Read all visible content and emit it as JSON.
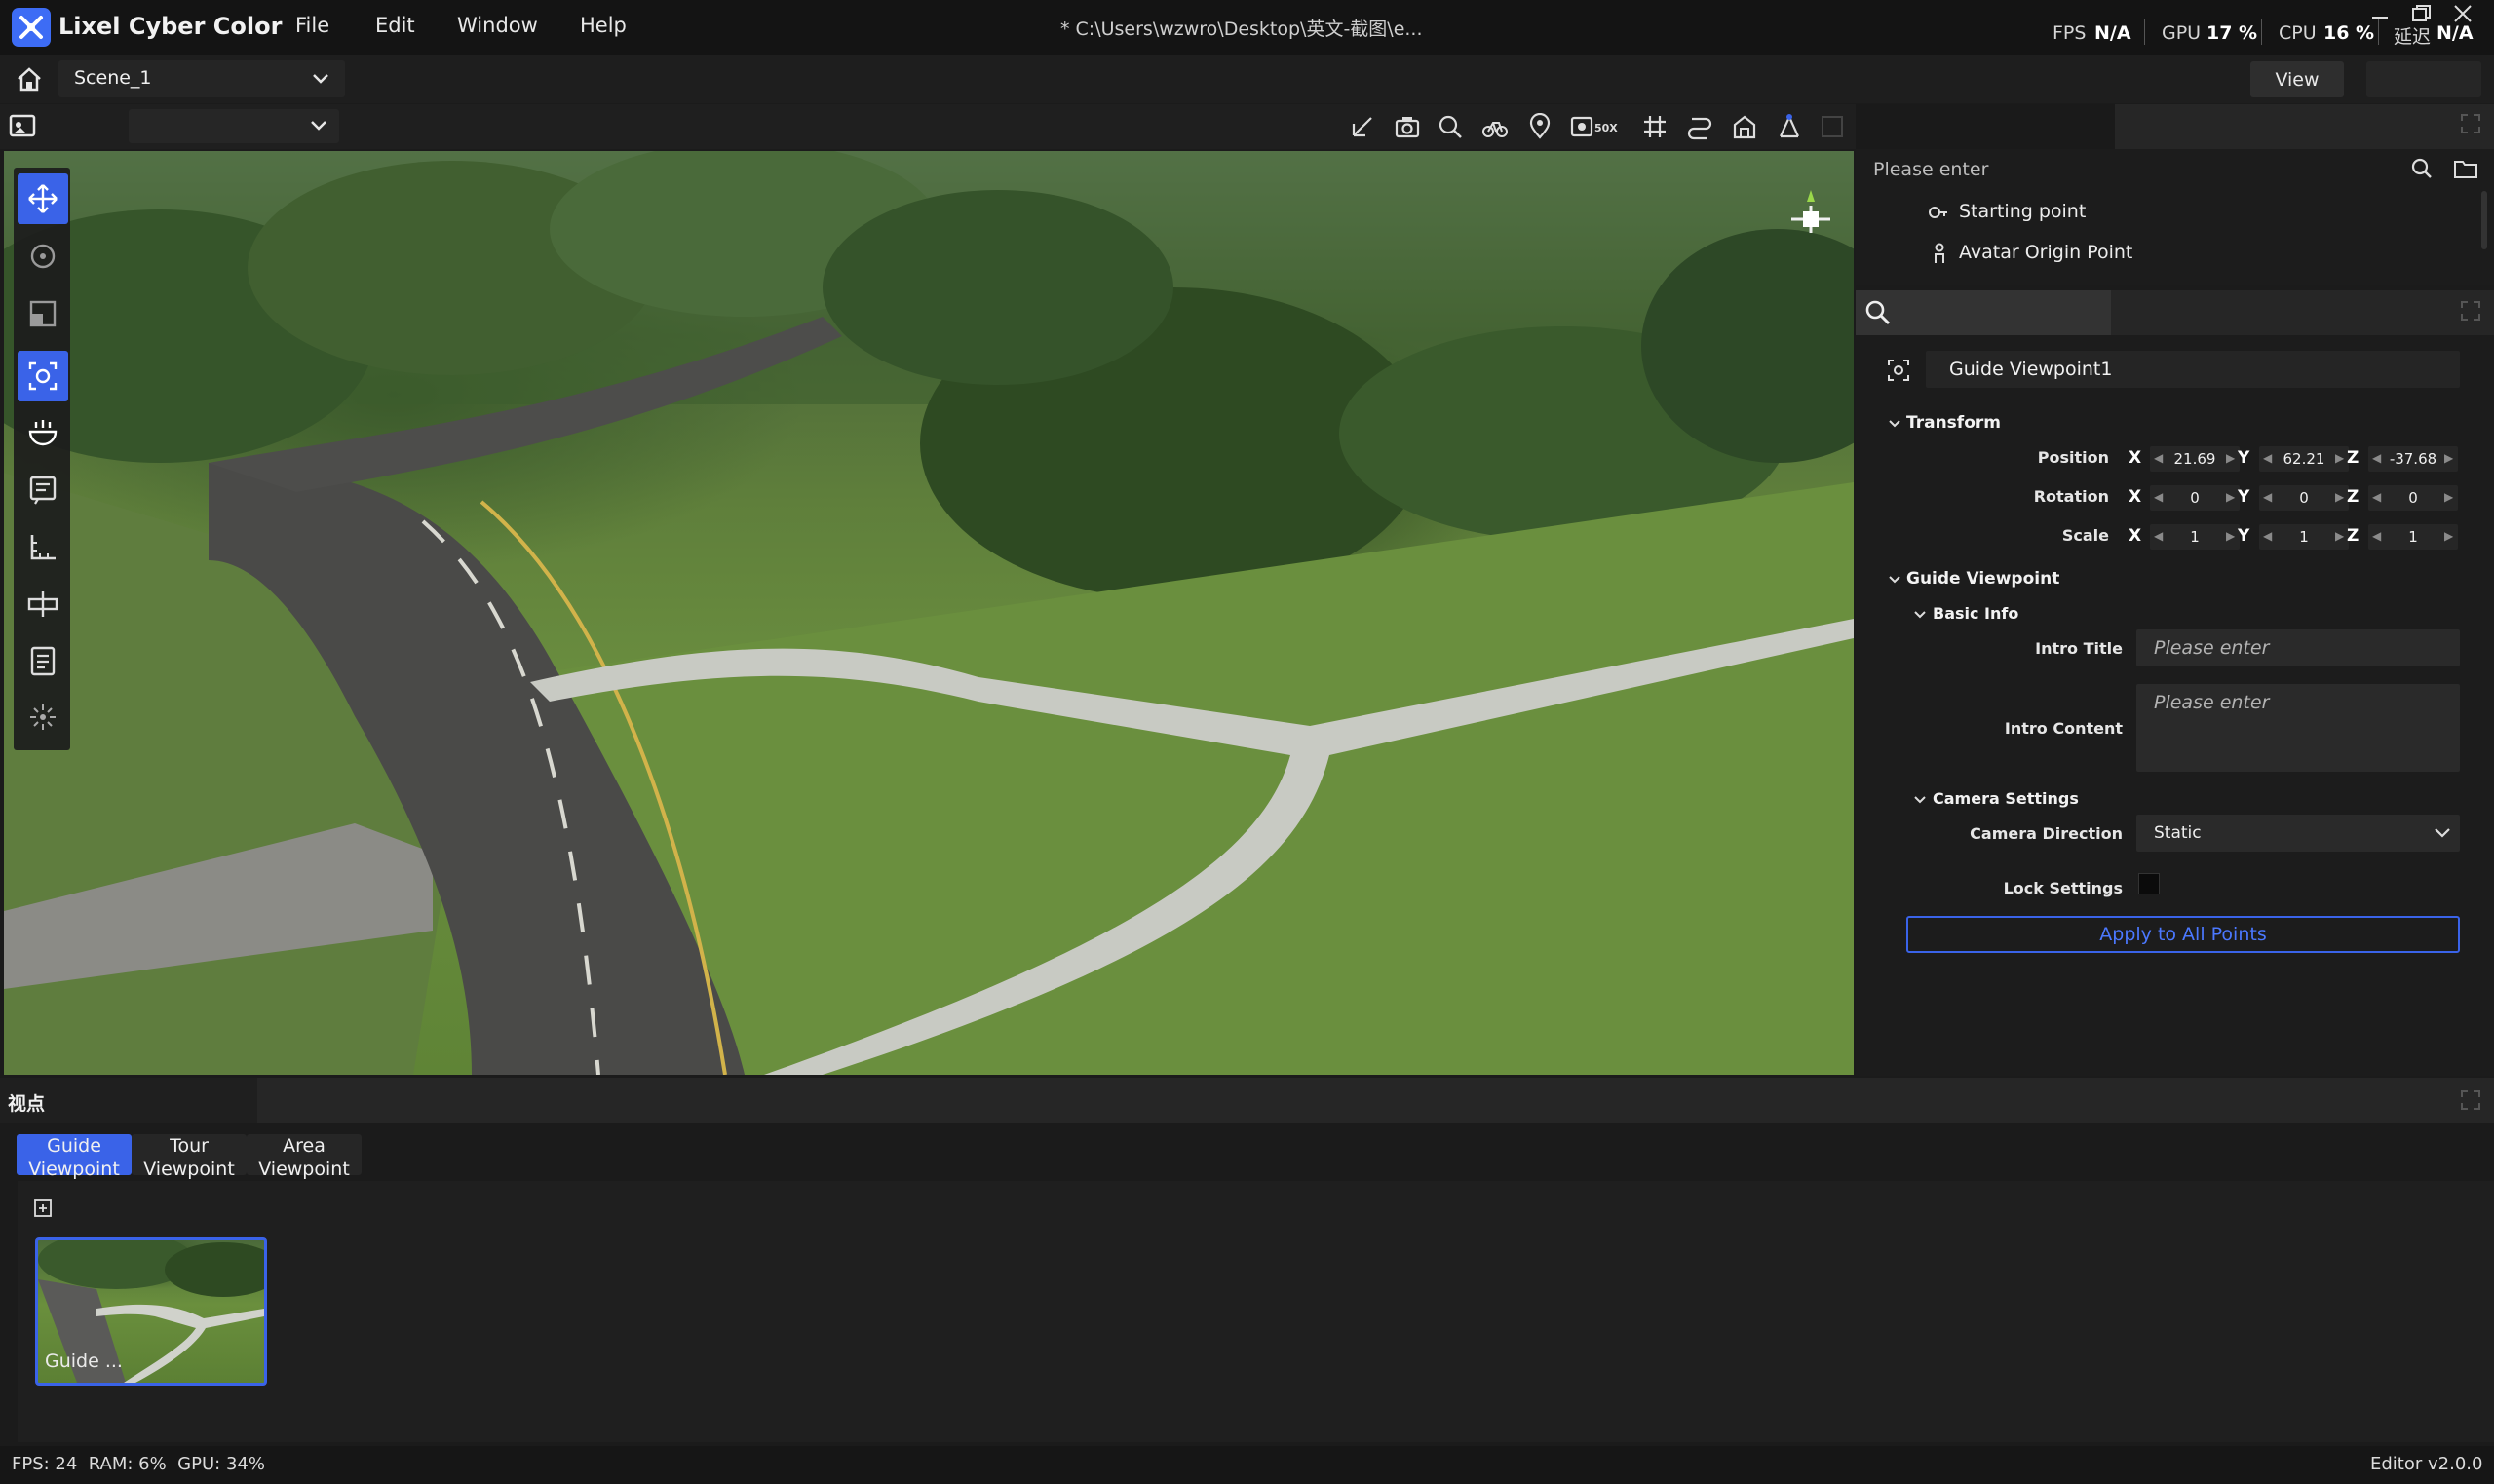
{
  "app": {
    "title": "Lixel Cyber Color",
    "menu": [
      "File",
      "Edit",
      "Window",
      "Help"
    ],
    "file_path": "* C:\\Users\\wzwro\\Desktop\\英文-截图\\e...",
    "stats": {
      "fps_label": "FPS",
      "fps_value": "N/A",
      "gpu_label": "GPU",
      "gpu_value": "17 %",
      "cpu_label": "CPU",
      "cpu_value": "16 %",
      "latency_label": "延迟",
      "latency_value": "N/A"
    }
  },
  "scene": {
    "selected": "Scene_1",
    "view_button": "View"
  },
  "outline": {
    "search_placeholder": "Please enter",
    "items": [
      {
        "label": "Starting point",
        "icon": "key-icon"
      },
      {
        "label": "Avatar Origin Point",
        "icon": "person-icon"
      }
    ]
  },
  "properties": {
    "entity_name": "Guide Viewpoint1",
    "transform": {
      "title": "Transform",
      "position_label": "Position",
      "rotation_label": "Rotation",
      "scale_label": "Scale",
      "axes": [
        "X",
        "Y",
        "Z"
      ],
      "position": [
        "21.69",
        "62.21",
        "-37.68"
      ],
      "rotation": [
        "0",
        "0",
        "0"
      ],
      "scale": [
        "1",
        "1",
        "1"
      ]
    },
    "guide_viewpoint": {
      "title": "Guide Viewpoint",
      "basic_info": "Basic Info",
      "intro_title_label": "Intro Title",
      "intro_title_placeholder": "Please enter",
      "intro_content_label": "Intro Content",
      "intro_content_placeholder": "Please enter",
      "camera_settings": "Camera Settings",
      "camera_direction_label": "Camera Direction",
      "camera_direction_value": "Static",
      "lock_settings_label": "Lock Settings",
      "apply_button": "Apply to All Points"
    }
  },
  "bottom": {
    "panel_title": "视点",
    "tabs": [
      {
        "line1": "Guide",
        "line2": "Viewpoint",
        "active": true
      },
      {
        "line1": "Tour",
        "line2": "Viewpoint",
        "active": false
      },
      {
        "line1": "Area",
        "line2": "Viewpoint",
        "active": false
      }
    ],
    "thumbnail_label": "Guide ..."
  },
  "status": {
    "left": "FPS: 24  RAM: 6%  GPU: 34%",
    "right": "Editor v2.0.0"
  },
  "colors": {
    "accent": "#3a63e8",
    "panel": "#1c1c1c",
    "titlebar": "#141414"
  }
}
